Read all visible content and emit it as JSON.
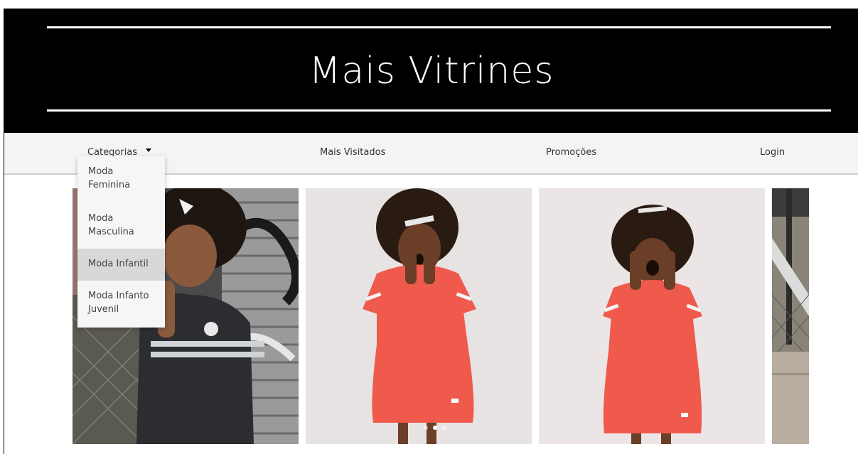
{
  "site": {
    "title": "Mais Vitrines"
  },
  "nav": {
    "categories": "Categorias",
    "most_visited": "Mais Visitados",
    "promotions": "Promoções",
    "login": "Login"
  },
  "dropdown": {
    "items": [
      {
        "label": "Moda Feminina"
      },
      {
        "label": "Moda Masculina"
      },
      {
        "label": "Moda Infantil",
        "hovered": true
      },
      {
        "label": "Moda Infanto Juvenil"
      }
    ]
  },
  "carousel": {
    "slides": [
      {
        "alt": "child-black-outfit-graffiti"
      },
      {
        "alt": "child-red-dress-surprised"
      },
      {
        "alt": "child-red-dress-screaming"
      },
      {
        "alt": "street-stairs-graffiti"
      }
    ],
    "active_dot": 1,
    "dot_count": 3
  },
  "colors": {
    "header_bg": "#000000",
    "nav_bg": "#f4f4f4",
    "dress_red": "#ef5a4d"
  }
}
